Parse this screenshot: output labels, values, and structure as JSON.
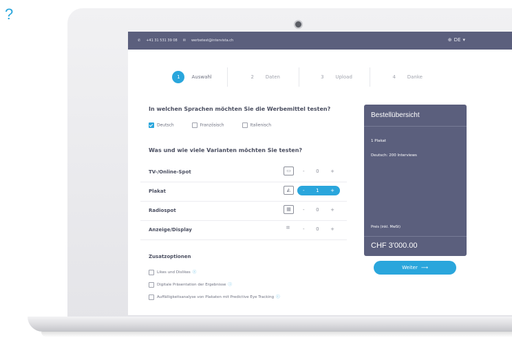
{
  "overlay": {
    "help_glyph": "?"
  },
  "topbar": {
    "phone": "+41 31 531 39 08",
    "email": "werbetest@intervista.ch",
    "language": "DE"
  },
  "stepper": {
    "steps": [
      {
        "num": "1",
        "label": "Auswahl"
      },
      {
        "num": "2",
        "label": "Daten"
      },
      {
        "num": "3",
        "label": "Upload"
      },
      {
        "num": "4",
        "label": "Danke"
      }
    ],
    "active_index": 0
  },
  "languages": {
    "question": "In welchen Sprachen möchten Sie die Werbemittel testen?",
    "options": [
      {
        "label": "Deutsch",
        "checked": true
      },
      {
        "label": "Französisch",
        "checked": false
      },
      {
        "label": "Italienisch",
        "checked": false
      }
    ]
  },
  "variants": {
    "question": "Was und wie viele Varianten möchten Sie testen?",
    "rows": [
      {
        "label": "TV-/Online-Spot",
        "icon": "video-icon",
        "count": "0",
        "minus": "-",
        "plus": "+"
      },
      {
        "label": "Plakat",
        "icon": "image-icon",
        "count": "1",
        "minus": "-",
        "plus": "+"
      },
      {
        "label": "Radiospot",
        "icon": "radio-icon",
        "count": "0",
        "minus": "-",
        "plus": "+"
      },
      {
        "label": "Anzeige/Display",
        "icon": "tag-icon",
        "count": "0",
        "minus": "-",
        "plus": "+"
      }
    ]
  },
  "extras": {
    "title": "Zusatzoptionen",
    "options": [
      {
        "label": "Likes und Dislikes"
      },
      {
        "label": "Digitale Präsentation der Ergebnisse"
      },
      {
        "label": "Auffälligkeitsanalyse von Plakaten mit Predictive Eye Tracking"
      }
    ]
  },
  "summary": {
    "title": "Bestellübersicht",
    "item1": "1 Plakat",
    "item2": "Deutsch: 200 Interviews",
    "price_label": "Preis (inkl. MwSt)",
    "price": "CHF 3'000.00"
  },
  "cta": {
    "label": "Weiter",
    "arrow": "⟶"
  },
  "colors": {
    "accent": "#2aa6dc",
    "brand": "#5b5f7d"
  }
}
